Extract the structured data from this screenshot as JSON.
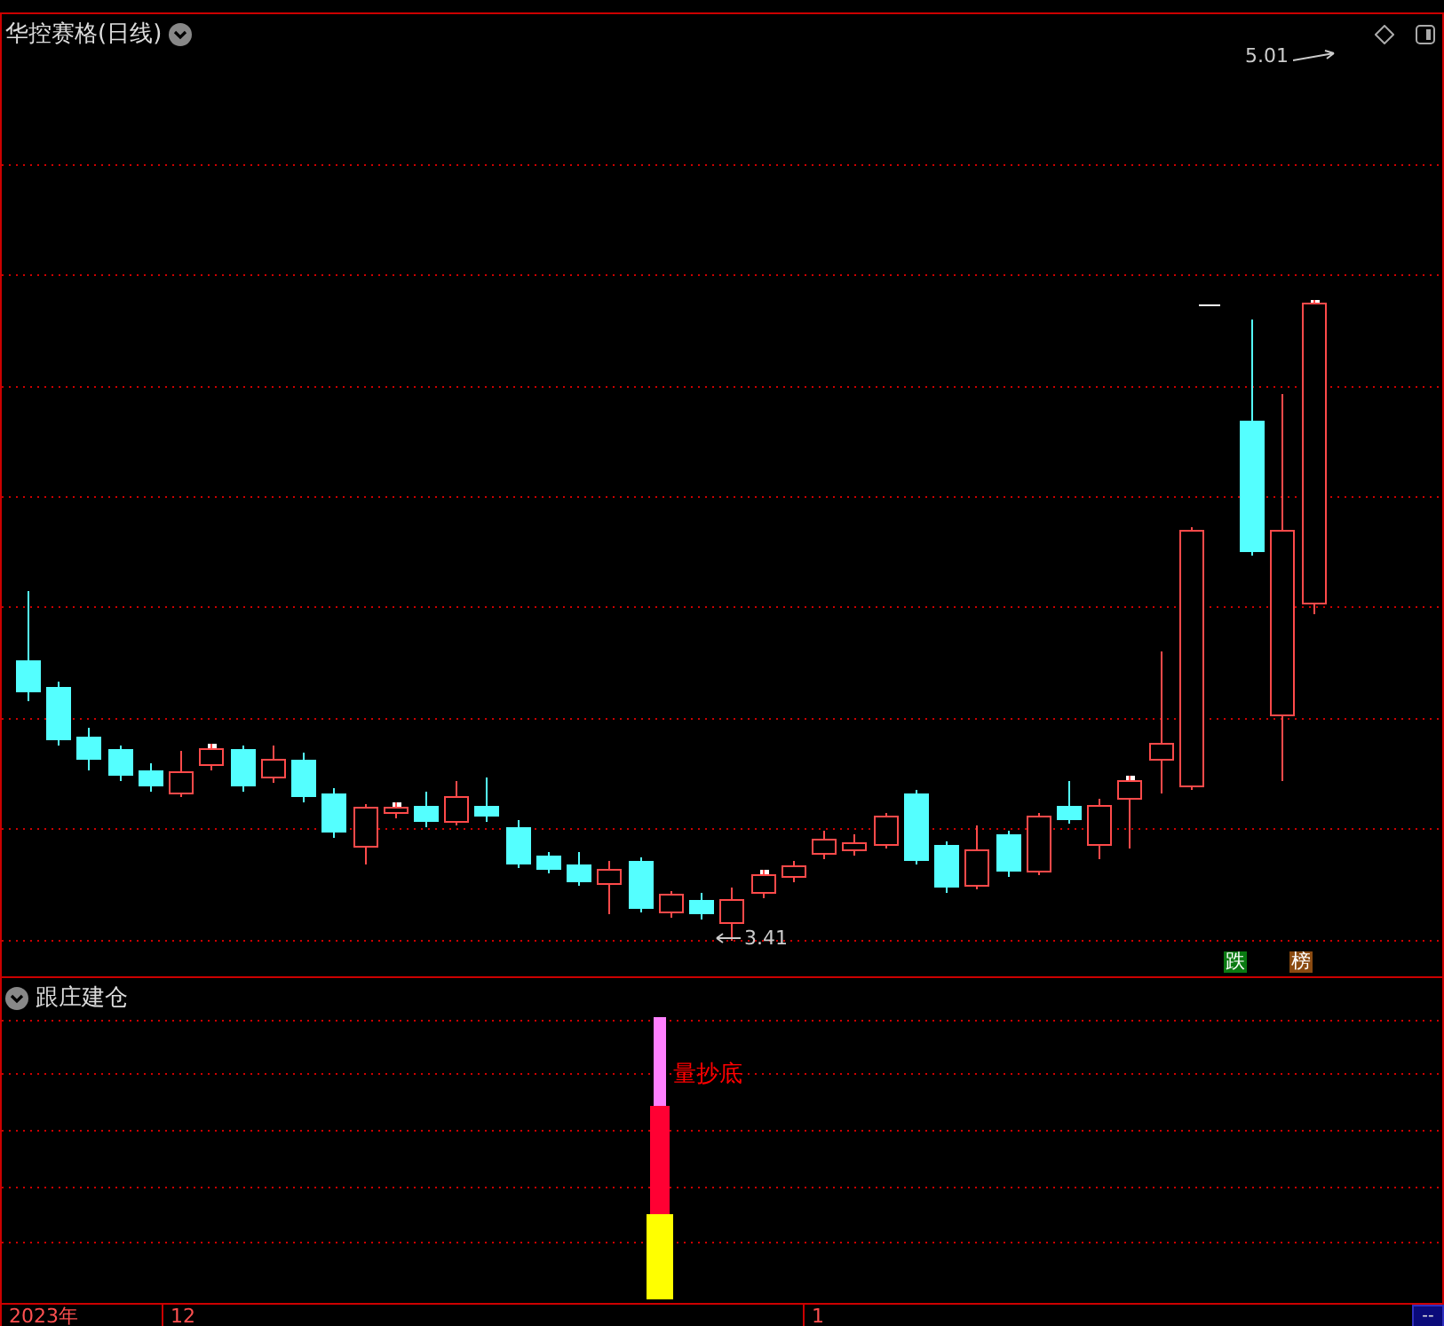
{
  "main_panel": {
    "title": "华控赛格(日线)",
    "price_labels": [
      {
        "text": "5.01",
        "kind": "high"
      },
      {
        "text": "3.41",
        "kind": "low"
      }
    ],
    "badges": [
      {
        "text": "跌",
        "color": "#0a7a12"
      },
      {
        "text": "榜",
        "color": "#8a4a10"
      }
    ]
  },
  "indicator_panel": {
    "title": "跟庄建仓",
    "signal_label": "量抄底"
  },
  "time_axis": {
    "labels": [
      "2023年",
      "12",
      "1"
    ],
    "corner_button": "--"
  }
}
